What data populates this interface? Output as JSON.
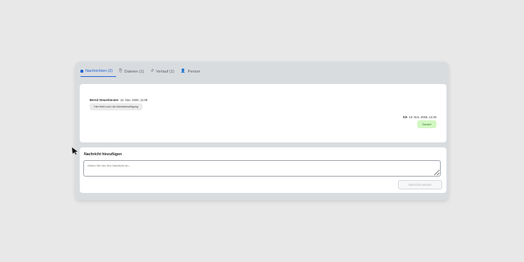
{
  "tabs": [
    {
      "label": "Nachrichten (2)",
      "icon": "chat-icon",
      "active": true
    },
    {
      "label": "Dateien (1)",
      "icon": "paperclip-icon",
      "active": false
    },
    {
      "label": "Verlauf (1)",
      "icon": "history-icon",
      "active": false
    },
    {
      "label": "Person",
      "icon": "person-icon",
      "active": false
    }
  ],
  "messages": [
    {
      "sender": "Bernd Steuerberater",
      "time": "13. Nov. 2025, 11:06",
      "text": "Hier fehlt noch die Arbeitsbewilligung"
    },
    {
      "sender": "Sie",
      "time": "13. Nov. 2025, 12:40",
      "text": "Danke!"
    }
  ],
  "compose": {
    "title": "Nachricht hinzufügen",
    "placeholder": "Geben Sie hier Ihre Nachricht ein...",
    "send_label": "Nachricht senden"
  },
  "colors": {
    "accent": "#1f62d6",
    "own_bubble": "#d2f7c2"
  }
}
